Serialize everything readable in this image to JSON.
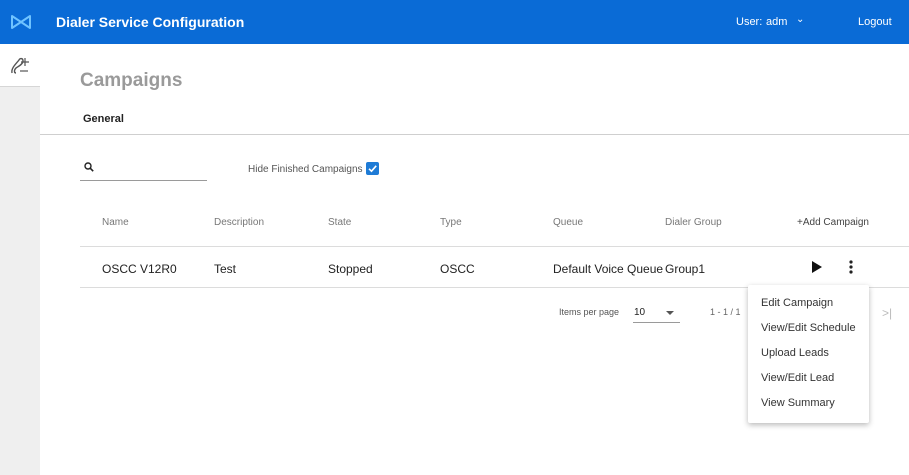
{
  "header": {
    "title": "Dialer Service Configuration",
    "user_label": "User:",
    "user_name": "adm",
    "logout_label": "Logout",
    "brand_color": "#0a6bd6"
  },
  "page": {
    "title": "Campaigns",
    "tabs": [
      {
        "label": "General"
      }
    ]
  },
  "filters": {
    "search_value": "",
    "hide_finished_label": "Hide Finished Campaigns",
    "hide_finished_checked": true
  },
  "table": {
    "columns": [
      "Name",
      "Description",
      "State",
      "Type",
      "Queue",
      "Dialer Group"
    ],
    "add_label": "+Add Campaign",
    "rows": [
      {
        "name": "OSCC V12R0",
        "description": "Test",
        "state": "Stopped",
        "type": "OSCC",
        "queue": "Default Voice Queue",
        "dialer_group": "Group1"
      }
    ]
  },
  "pagination": {
    "items_per_page_label": "Items per page",
    "items_per_page": "10",
    "range": "1 - 1 / 1"
  },
  "row_menu": {
    "items": [
      "Edit Campaign",
      "View/Edit Schedule",
      "Upload Leads",
      "View/Edit Lead",
      "View Summary"
    ]
  },
  "icons": [
    "dialer-logo-icon",
    "campaign-nav-icon",
    "search-icon",
    "checkbox-check-icon",
    "chevron-down-icon",
    "play-icon",
    "more-vertical-icon",
    "last-page-icon"
  ]
}
